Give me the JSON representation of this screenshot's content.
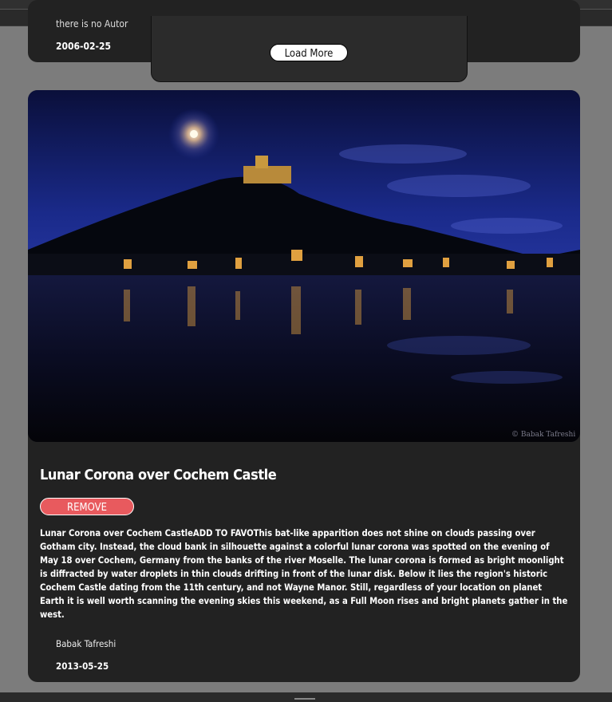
{
  "previous_card": {
    "author_snippet": "there is no Autor",
    "date": "2006-02-25"
  },
  "load_more": {
    "label": "Load More"
  },
  "post": {
    "title": "Lunar Corona over Cochem Castle",
    "image_credit": "© Babak Tafreshi",
    "remove_label": "REMOVE",
    "description": "Lunar Corona over Cochem CastleADD TO FAVOThis bat-like apparition does not shine on clouds passing over Gotham city. Instead, the cloud bank in silhouette against a colorful lunar corona was spotted on the evening of May 18 over Cochem, Germany from the banks of the river Moselle. The lunar corona is formed as bright moonlight is diffracted by water droplets in thin clouds drifting in front of the lunar disk. Below it lies the region's historic Cochem Castle dating from the 11th century, and not Wayne Manor. Still, regardless of your location on planet Earth it is well worth scanning the evening skies this weekend, as a Full Moon rises and bright planets gather in the west.",
    "author": "Babak Tafreshi",
    "date": "2013-05-25"
  },
  "colors": {
    "page_background": "#7c7c7c",
    "card_background": "#222222",
    "remove_button": "#e85a5e",
    "load_more_button": "#ffffff"
  }
}
